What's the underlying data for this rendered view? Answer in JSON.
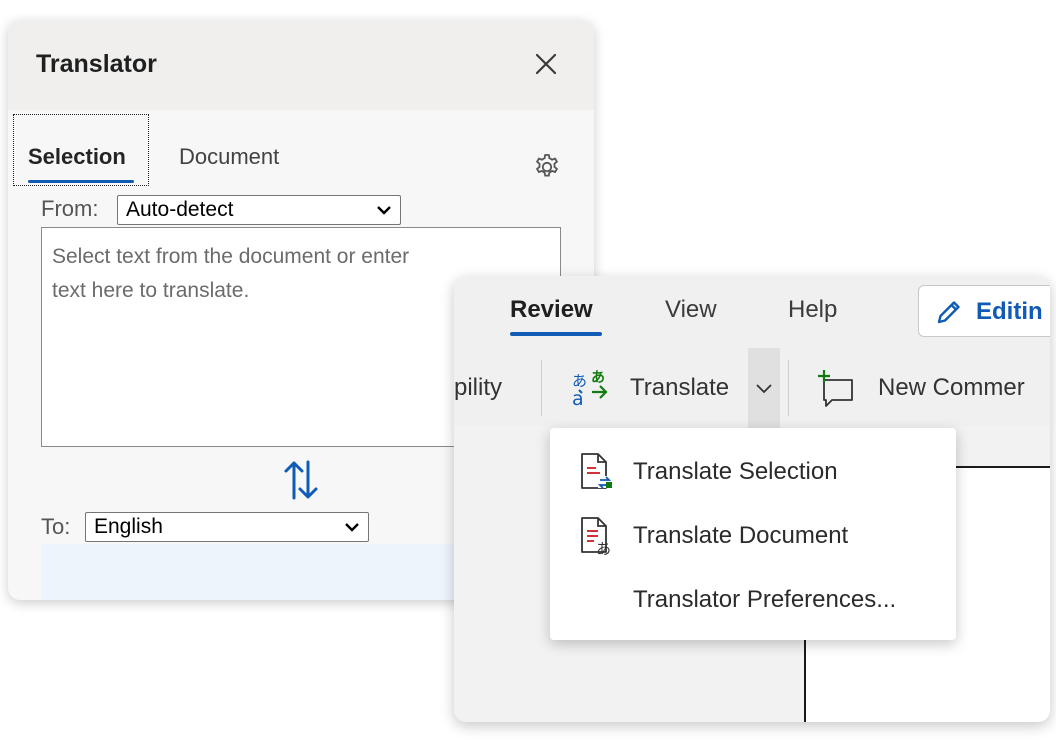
{
  "translator_pane": {
    "title": "Translator",
    "tabs": [
      {
        "label": "Selection",
        "active": true
      },
      {
        "label": "Document",
        "active": false
      }
    ],
    "from_label": "From:",
    "from_value": "Auto-detect",
    "input_placeholder": "Select text from the document or enter\ntext here to translate.",
    "to_label": "To:",
    "to_value": "English"
  },
  "ribbon": {
    "tabs": [
      {
        "label": "Review",
        "active": true
      },
      {
        "label": "View",
        "active": false
      },
      {
        "label": "Help",
        "active": false
      }
    ],
    "editing_label": "Editin",
    "accessibility_partial": "pility",
    "translate_label": "Translate",
    "new_comment_partial": "New Commer"
  },
  "translate_menu": {
    "items": [
      {
        "label": "Translate Selection",
        "icon": "translate-selection-icon"
      },
      {
        "label": "Translate Document",
        "icon": "translate-document-icon"
      },
      {
        "label": "Translator Preferences...",
        "icon": ""
      }
    ]
  },
  "colors": {
    "accent": "#0f5bb5",
    "pane_header": "#f0efee",
    "output_strip": "#eef4fc",
    "icon_red": "#d13438",
    "icon_green": "#107c10"
  }
}
